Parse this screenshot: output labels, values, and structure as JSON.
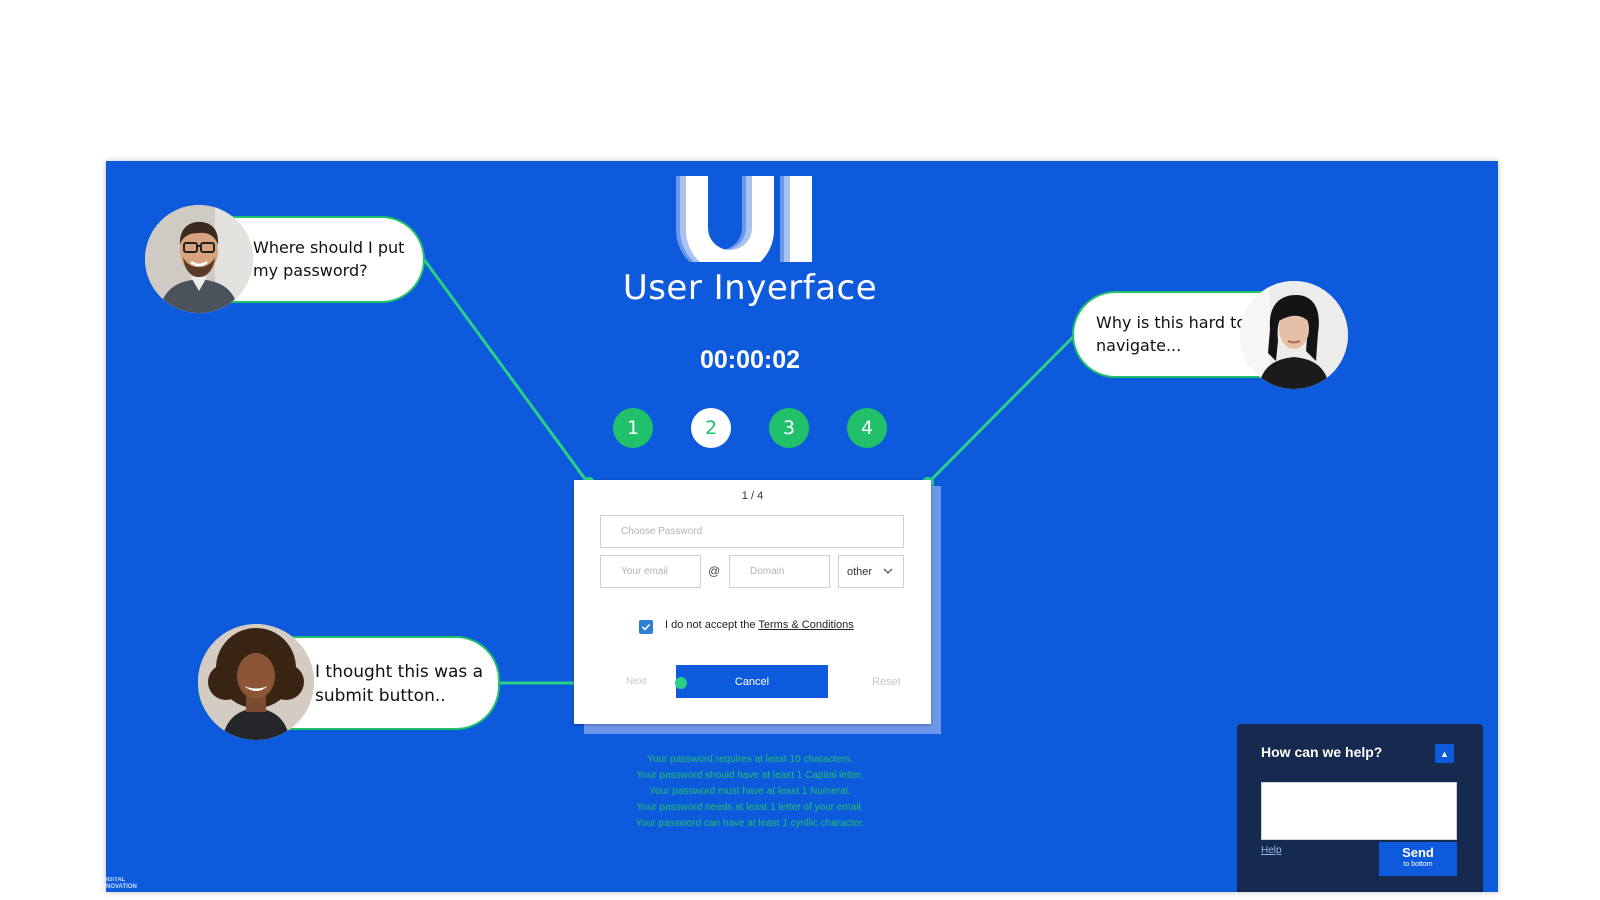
{
  "app": {
    "logo_text": "UI",
    "title": "User Inyerface",
    "timer": "00:00:02"
  },
  "steps": [
    {
      "label": "1",
      "active": false
    },
    {
      "label": "2",
      "active": true
    },
    {
      "label": "3",
      "active": false
    },
    {
      "label": "4",
      "active": false
    }
  ],
  "card": {
    "page_indicator": "1 / 4",
    "password_placeholder": "Choose Password",
    "email_placeholder": "Your email",
    "at_sign": "@",
    "domain_placeholder": "Domain",
    "tld_selected": "other",
    "terms_checked": true,
    "terms_prefix": "I do not accept the",
    "terms_link": "Terms & Conditions",
    "next_label": "Next",
    "cancel_label": "Cancel",
    "reset_label": "Reset"
  },
  "hints": [
    "Your password requires at least 10 characters.",
    "Your password should have at least 1 Capital letter.",
    "Your password must have at least 1 Numeral.",
    "Your password needs at least 1 letter of your email.",
    "Your password can have at least 1 cyrillic character."
  ],
  "bubbles": {
    "top_left": "Where should I put my password?",
    "top_right": "Why is this hard to navigate...",
    "bottom_left": "I thought this was a submit button.."
  },
  "chat": {
    "title": "How can we help?",
    "toggle_icon": "chevron-up-icon",
    "help_label": "Help",
    "send_label": "Send",
    "send_sub": "to bottom"
  },
  "corner_logo": [
    "IGITAL",
    "NOVATION"
  ],
  "colors": {
    "panel_blue": "#0d5add",
    "accent_green": "#21c06a",
    "chat_navy": "#16294f"
  }
}
